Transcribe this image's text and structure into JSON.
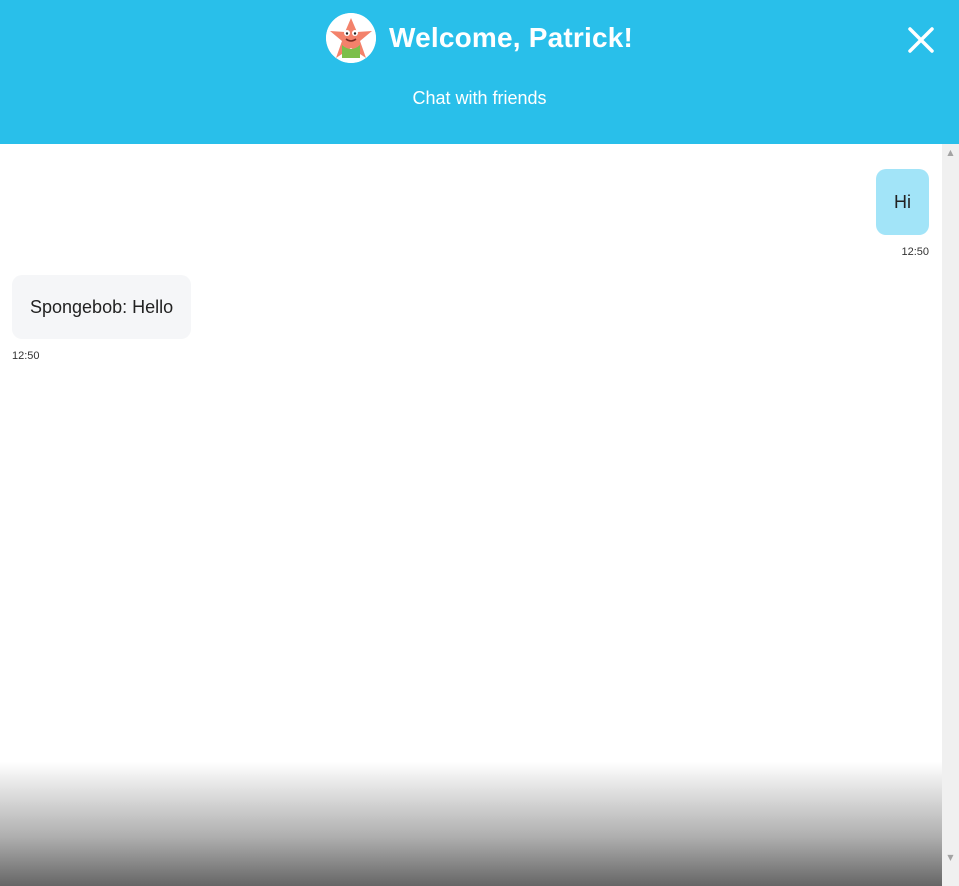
{
  "header": {
    "title": "Welcome, Patrick!",
    "subtitle": "Chat with friends",
    "avatar_icon": "patrick-avatar",
    "close_icon": "close-icon",
    "background_color": "#29bfea"
  },
  "messages": [
    {
      "direction": "outgoing",
      "text": "Hi",
      "time": "12:50",
      "bubble_color": "#a2e4f8"
    },
    {
      "direction": "incoming",
      "text": "Spongebob: Hello",
      "time": "12:50",
      "bubble_color": "#f5f6f8"
    }
  ],
  "scrollbar": {
    "up_arrow": "▲",
    "down_arrow": "▼"
  }
}
